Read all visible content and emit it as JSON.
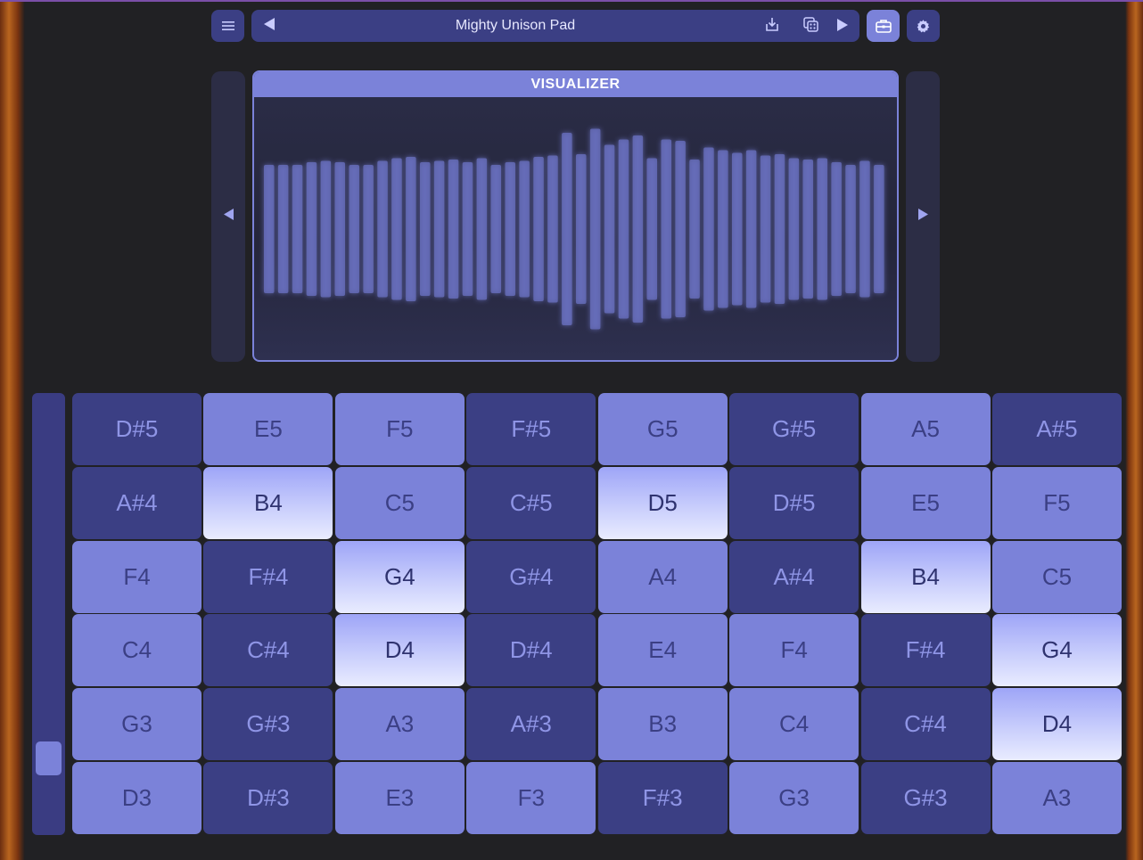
{
  "toolbar": {
    "menu_icon": "menu-icon",
    "preset_name": "Mighty Unison Pad",
    "prev_icon": "triangle-left-icon",
    "save_icon": "save-icon",
    "random_icon": "dice-icon",
    "next_icon": "triangle-right-icon",
    "tools_icon": "toolbox-icon",
    "settings_icon": "gear-icon"
  },
  "visualizer": {
    "title": "VISUALIZER",
    "bar_heights": [
      0.48,
      0.48,
      0.48,
      0.5,
      0.51,
      0.5,
      0.48,
      0.48,
      0.51,
      0.53,
      0.54,
      0.5,
      0.51,
      0.52,
      0.5,
      0.53,
      0.48,
      0.5,
      0.51,
      0.54,
      0.55,
      0.72,
      0.56,
      0.75,
      0.63,
      0.67,
      0.7,
      0.53,
      0.67,
      0.66,
      0.52,
      0.61,
      0.59,
      0.57,
      0.59,
      0.55,
      0.56,
      0.53,
      0.52,
      0.53,
      0.5,
      0.48,
      0.51,
      0.48
    ]
  },
  "colors": {
    "panel": "#212124",
    "pad_dark": "#3b3f84",
    "pad_mid": "#7b82d9",
    "pad_lit": "#e9ecff"
  },
  "slider": {
    "level": 0.14
  },
  "pads": [
    [
      {
        "note": "D#5",
        "state": "dark"
      },
      {
        "note": "E5",
        "state": "mid"
      },
      {
        "note": "F5",
        "state": "mid"
      },
      {
        "note": "F#5",
        "state": "dark"
      },
      {
        "note": "G5",
        "state": "mid"
      },
      {
        "note": "G#5",
        "state": "dark"
      },
      {
        "note": "A5",
        "state": "mid"
      },
      {
        "note": "A#5",
        "state": "dark"
      }
    ],
    [
      {
        "note": "A#4",
        "state": "dark"
      },
      {
        "note": "B4",
        "state": "lit"
      },
      {
        "note": "C5",
        "state": "mid"
      },
      {
        "note": "C#5",
        "state": "dark"
      },
      {
        "note": "D5",
        "state": "lit"
      },
      {
        "note": "D#5",
        "state": "dark"
      },
      {
        "note": "E5",
        "state": "mid"
      },
      {
        "note": "F5",
        "state": "mid"
      }
    ],
    [
      {
        "note": "F4",
        "state": "mid"
      },
      {
        "note": "F#4",
        "state": "dark"
      },
      {
        "note": "G4",
        "state": "lit"
      },
      {
        "note": "G#4",
        "state": "dark"
      },
      {
        "note": "A4",
        "state": "mid"
      },
      {
        "note": "A#4",
        "state": "dark"
      },
      {
        "note": "B4",
        "state": "lit"
      },
      {
        "note": "C5",
        "state": "mid"
      }
    ],
    [
      {
        "note": "C4",
        "state": "mid"
      },
      {
        "note": "C#4",
        "state": "dark"
      },
      {
        "note": "D4",
        "state": "lit"
      },
      {
        "note": "D#4",
        "state": "dark"
      },
      {
        "note": "E4",
        "state": "mid"
      },
      {
        "note": "F4",
        "state": "mid"
      },
      {
        "note": "F#4",
        "state": "dark"
      },
      {
        "note": "G4",
        "state": "lit"
      }
    ],
    [
      {
        "note": "G3",
        "state": "mid"
      },
      {
        "note": "G#3",
        "state": "dark"
      },
      {
        "note": "A3",
        "state": "mid"
      },
      {
        "note": "A#3",
        "state": "dark"
      },
      {
        "note": "B3",
        "state": "mid"
      },
      {
        "note": "C4",
        "state": "mid"
      },
      {
        "note": "C#4",
        "state": "dark"
      },
      {
        "note": "D4",
        "state": "lit"
      }
    ],
    [
      {
        "note": "D3",
        "state": "mid"
      },
      {
        "note": "D#3",
        "state": "dark"
      },
      {
        "note": "E3",
        "state": "mid"
      },
      {
        "note": "F3",
        "state": "mid"
      },
      {
        "note": "F#3",
        "state": "dark"
      },
      {
        "note": "G3",
        "state": "mid"
      },
      {
        "note": "G#3",
        "state": "dark"
      },
      {
        "note": "A3",
        "state": "mid"
      }
    ]
  ]
}
